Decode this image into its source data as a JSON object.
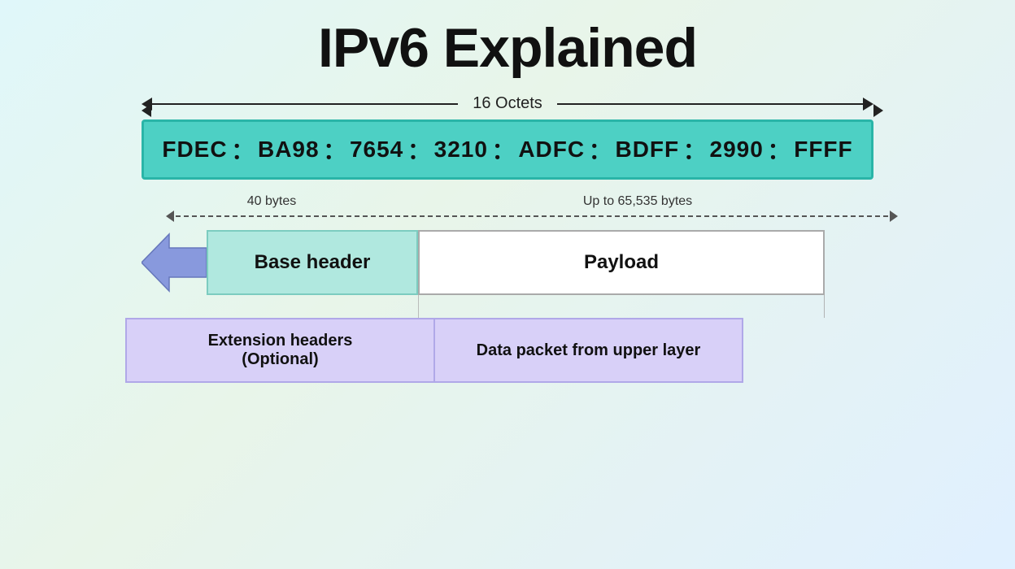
{
  "title": "IPv6 Explained",
  "octets_label": "16 Octets",
  "ipv6_segments": [
    "FDEC",
    "BA98",
    "7654",
    "3210",
    "ADFC",
    "BDFF",
    "2990",
    "FFFF"
  ],
  "dim_left_label": "40 bytes",
  "dim_right_label": "Up to 65,535 bytes",
  "base_header_label": "Base header",
  "payload_label": "Payload",
  "extension_label": "Extension headers\n(Optional)",
  "data_label": "Data packet from upper layer"
}
